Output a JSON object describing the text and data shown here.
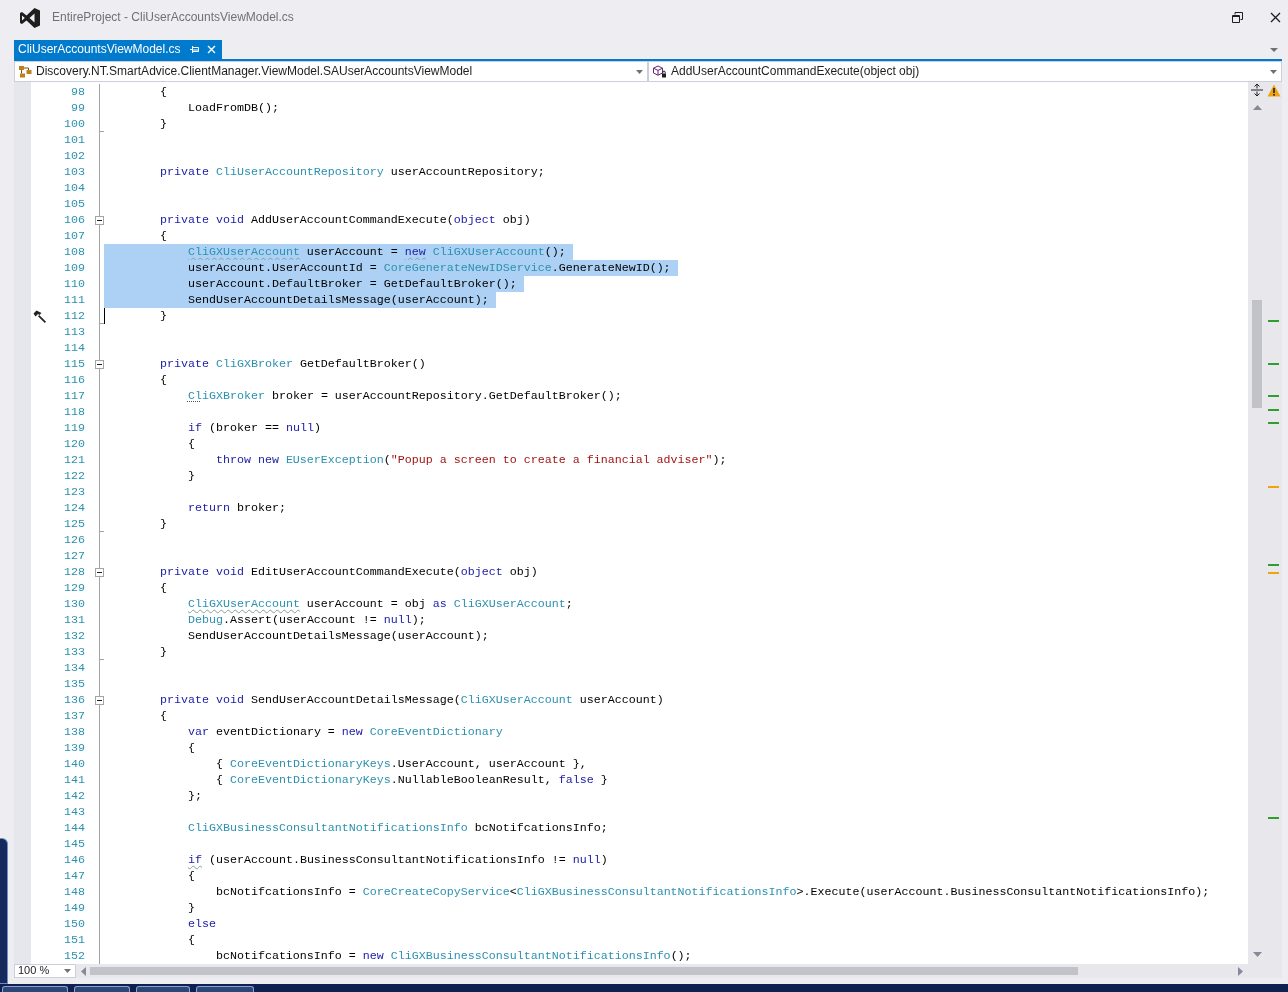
{
  "window": {
    "title": "EntireProject - CliUserAccountsViewModel.cs"
  },
  "tabs": [
    {
      "label": "CliUserAccountsViewModel.cs",
      "selected": true
    }
  ],
  "navigation_bar": {
    "type_scope": "Discovery.NT.SmartAdvice.ClientManager.ViewModel.SAUserAccountsViewModel",
    "member_scope": "AddUserAccountCommandExecute(object obj)"
  },
  "editor": {
    "lines": [
      {
        "number": "98",
        "selected": false,
        "tokens": [
          {
            "text": "        {",
            "kind": "plain"
          }
        ]
      },
      {
        "number": "99",
        "selected": false,
        "tokens": [
          {
            "text": "            LoadFromDB();",
            "kind": "plain"
          }
        ]
      },
      {
        "number": "100",
        "selected": false,
        "fold_end": true,
        "tokens": [
          {
            "text": "        }",
            "kind": "plain"
          }
        ]
      },
      {
        "number": "101",
        "selected": false
      },
      {
        "number": "102",
        "selected": false
      },
      {
        "number": "103",
        "selected": false,
        "tokens": [
          {
            "text": "        private ",
            "kind": "keyword"
          },
          {
            "text": "CliUserAccountRepository",
            "kind": "type"
          },
          {
            "text": " userAccountRepository;",
            "kind": "plain"
          }
        ]
      },
      {
        "number": "104",
        "selected": false
      },
      {
        "number": "105",
        "selected": false
      },
      {
        "number": "106",
        "selected": false,
        "expanded": true,
        "tokens": [
          {
            "text": "        private void ",
            "kind": "keyword"
          },
          {
            "text": "AddUserAccountCommandExecute(",
            "kind": "plain"
          },
          {
            "text": "object",
            "kind": "keyword"
          },
          {
            "text": " obj)",
            "kind": "plain"
          }
        ]
      },
      {
        "number": "107",
        "selected": false,
        "tokens": [
          {
            "text": "        {",
            "kind": "plain"
          }
        ]
      },
      {
        "number": "108",
        "selected": true,
        "tokens": [
          {
            "text": "            CliGXUserAccount",
            "kind": "type",
            "squiggle": true
          },
          {
            "text": " userAccount = ",
            "kind": "plain"
          },
          {
            "text": "new",
            "kind": "keyword",
            "squiggle": true
          },
          {
            "text": " CliGXUserAccount",
            "kind": "type"
          },
          {
            "text": "();",
            "kind": "plain"
          }
        ]
      },
      {
        "number": "109",
        "selected": true,
        "tokens": [
          {
            "text": "            userAccount.UserAccountId = ",
            "kind": "plain"
          },
          {
            "text": "CoreGenerateNewIDService",
            "kind": "type"
          },
          {
            "text": ".GenerateNewID();",
            "kind": "plain"
          }
        ]
      },
      {
        "number": "110",
        "selected": true,
        "tokens": [
          {
            "text": "            userAccount.DefaultBroker = GetDefaultBroker();",
            "kind": "plain"
          }
        ]
      },
      {
        "number": "111",
        "selected": true,
        "tokens": [
          {
            "text": "            SendUserAccountDetailsMessage(userAccount);",
            "kind": "plain"
          }
        ]
      },
      {
        "number": "112",
        "selected": false,
        "caret": true,
        "action_glyph": true,
        "fold_end": true,
        "tokens": [
          {
            "text": "        }",
            "kind": "plain"
          }
        ]
      },
      {
        "number": "113",
        "selected": false
      },
      {
        "number": "114",
        "selected": false
      },
      {
        "number": "115",
        "selected": false,
        "expanded": true,
        "tokens": [
          {
            "text": "        private ",
            "kind": "keyword"
          },
          {
            "text": "CliGXBroker",
            "kind": "type"
          },
          {
            "text": " GetDefaultBroker()",
            "kind": "plain"
          }
        ]
      },
      {
        "number": "116",
        "selected": false,
        "tokens": [
          {
            "text": "        {",
            "kind": "plain"
          }
        ]
      },
      {
        "number": "117",
        "selected": false,
        "tokens": [
          {
            "text": "            Cl",
            "kind": "type",
            "smart_tag": true
          },
          {
            "text": "iGXBroker",
            "kind": "type"
          },
          {
            "text": " broker = userAccountRepository.GetDefaultBroker();",
            "kind": "plain"
          }
        ]
      },
      {
        "number": "118",
        "selected": false
      },
      {
        "number": "119",
        "selected": false,
        "tokens": [
          {
            "text": "            if",
            "kind": "keyword"
          },
          {
            "text": " (broker == ",
            "kind": "plain"
          },
          {
            "text": "null",
            "kind": "keyword"
          },
          {
            "text": ")",
            "kind": "plain"
          }
        ]
      },
      {
        "number": "120",
        "selected": false,
        "tokens": [
          {
            "text": "            {",
            "kind": "plain"
          }
        ]
      },
      {
        "number": "121",
        "selected": false,
        "tokens": [
          {
            "text": "                throw new ",
            "kind": "keyword"
          },
          {
            "text": "EUserException",
            "kind": "type"
          },
          {
            "text": "(",
            "kind": "plain"
          },
          {
            "text": "\"Popup a screen to create a financial adviser\"",
            "kind": "string"
          },
          {
            "text": ");",
            "kind": "plain"
          }
        ]
      },
      {
        "number": "122",
        "selected": false,
        "tokens": [
          {
            "text": "            }",
            "kind": "plain"
          }
        ]
      },
      {
        "number": "123",
        "selected": false
      },
      {
        "number": "124",
        "selected": false,
        "tokens": [
          {
            "text": "            return",
            "kind": "keyword"
          },
          {
            "text": " broker;",
            "kind": "plain"
          }
        ]
      },
      {
        "number": "125",
        "selected": false,
        "fold_end": true,
        "tokens": [
          {
            "text": "        }",
            "kind": "plain"
          }
        ]
      },
      {
        "number": "126",
        "selected": false
      },
      {
        "number": "127",
        "selected": false
      },
      {
        "number": "128",
        "selected": false,
        "expanded": true,
        "tokens": [
          {
            "text": "        private void ",
            "kind": "keyword"
          },
          {
            "text": "EditUserAccountCommandExecute(",
            "kind": "plain"
          },
          {
            "text": "object",
            "kind": "keyword"
          },
          {
            "text": " obj)",
            "kind": "plain"
          }
        ]
      },
      {
        "number": "129",
        "selected": false,
        "tokens": [
          {
            "text": "        {",
            "kind": "plain"
          }
        ]
      },
      {
        "number": "130",
        "selected": false,
        "tokens": [
          {
            "text": "            CliGXUserAccount",
            "kind": "type",
            "squiggle": true
          },
          {
            "text": " userAccount = obj ",
            "kind": "plain"
          },
          {
            "text": "as",
            "kind": "keyword"
          },
          {
            "text": " CliGXUserAccount",
            "kind": "type"
          },
          {
            "text": ";",
            "kind": "plain"
          }
        ]
      },
      {
        "number": "131",
        "selected": false,
        "tokens": [
          {
            "text": "            Debug",
            "kind": "type"
          },
          {
            "text": ".Assert(userAccount != ",
            "kind": "plain"
          },
          {
            "text": "null",
            "kind": "keyword"
          },
          {
            "text": ");",
            "kind": "plain"
          }
        ]
      },
      {
        "number": "132",
        "selected": false,
        "tokens": [
          {
            "text": "            SendUserAccountDetailsMessage(userAccount);",
            "kind": "plain"
          }
        ]
      },
      {
        "number": "133",
        "selected": false,
        "fold_end": true,
        "tokens": [
          {
            "text": "        }",
            "kind": "plain"
          }
        ]
      },
      {
        "number": "134",
        "selected": false
      },
      {
        "number": "135",
        "selected": false
      },
      {
        "number": "136",
        "selected": false,
        "expanded": true,
        "tokens": [
          {
            "text": "        private void ",
            "kind": "keyword"
          },
          {
            "text": "SendUserAccountDetailsMessage(",
            "kind": "plain"
          },
          {
            "text": "CliGXUserAccount",
            "kind": "type"
          },
          {
            "text": " userAccount)",
            "kind": "plain"
          }
        ]
      },
      {
        "number": "137",
        "selected": false,
        "tokens": [
          {
            "text": "        {",
            "kind": "plain"
          }
        ]
      },
      {
        "number": "138",
        "selected": false,
        "tokens": [
          {
            "text": "            var",
            "kind": "keyword"
          },
          {
            "text": " eventDictionary = ",
            "kind": "plain"
          },
          {
            "text": "new",
            "kind": "keyword"
          },
          {
            "text": " CoreEventDictionary",
            "kind": "type"
          }
        ]
      },
      {
        "number": "139",
        "selected": false,
        "tokens": [
          {
            "text": "            {",
            "kind": "plain"
          }
        ]
      },
      {
        "number": "140",
        "selected": false,
        "tokens": [
          {
            "text": "                { ",
            "kind": "plain"
          },
          {
            "text": "CoreEventDictionaryKeys",
            "kind": "type"
          },
          {
            "text": ".UserAccount, userAccount },",
            "kind": "plain"
          }
        ]
      },
      {
        "number": "141",
        "selected": false,
        "tokens": [
          {
            "text": "                { ",
            "kind": "plain"
          },
          {
            "text": "CoreEventDictionaryKeys",
            "kind": "type"
          },
          {
            "text": ".NullableBooleanResult, ",
            "kind": "plain"
          },
          {
            "text": "false",
            "kind": "keyword"
          },
          {
            "text": " }",
            "kind": "plain"
          }
        ]
      },
      {
        "number": "142",
        "selected": false,
        "tokens": [
          {
            "text": "            };",
            "kind": "plain"
          }
        ]
      },
      {
        "number": "143",
        "selected": false
      },
      {
        "number": "144",
        "selected": false,
        "tokens": [
          {
            "text": "            CliGXBusinessConsultantNotificationsInfo",
            "kind": "type"
          },
          {
            "text": " bcNotifcationsInfo;",
            "kind": "plain"
          }
        ]
      },
      {
        "number": "145",
        "selected": false
      },
      {
        "number": "146",
        "selected": false,
        "tokens": [
          {
            "text": "            if",
            "kind": "keyword",
            "squiggle": true
          },
          {
            "text": " (userAccount.BusinessConsultantNotificationsInfo != ",
            "kind": "plain"
          },
          {
            "text": "null",
            "kind": "keyword"
          },
          {
            "text": ")",
            "kind": "plain"
          }
        ]
      },
      {
        "number": "147",
        "selected": false,
        "tokens": [
          {
            "text": "            {",
            "kind": "plain"
          }
        ]
      },
      {
        "number": "148",
        "selected": false,
        "tokens": [
          {
            "text": "                bcNotifcationsInfo = ",
            "kind": "plain"
          },
          {
            "text": "CoreCreateCopyService",
            "kind": "type"
          },
          {
            "text": "<",
            "kind": "plain"
          },
          {
            "text": "CliGXBusinessConsultantNotificationsInfo",
            "kind": "type"
          },
          {
            "text": ">.Execute(userAccount.BusinessConsultantNotificationsInfo);",
            "kind": "plain"
          }
        ]
      },
      {
        "number": "149",
        "selected": false,
        "tokens": [
          {
            "text": "            }",
            "kind": "plain"
          }
        ]
      },
      {
        "number": "150",
        "selected": false,
        "tokens": [
          {
            "text": "            else",
            "kind": "keyword"
          }
        ]
      },
      {
        "number": "151",
        "selected": false,
        "tokens": [
          {
            "text": "            {",
            "kind": "plain"
          }
        ]
      },
      {
        "number": "152",
        "selected": false,
        "tokens": [
          {
            "text": "                bcNotifcationsInfo = ",
            "kind": "plain"
          },
          {
            "text": "new",
            "kind": "keyword"
          },
          {
            "text": " CliGXBusinessConsultantNotificationsInfo",
            "kind": "type"
          },
          {
            "text": "();",
            "kind": "plain"
          }
        ]
      }
    ],
    "overview_marks": [
      {
        "color": "#2e9e2e"
      },
      {
        "color": "#2e9e2e"
      },
      {
        "color": "#2e9e2e"
      },
      {
        "color": "#2e9e2e"
      },
      {
        "color": "#2e9e2e"
      },
      {
        "color": "#f0a30a"
      },
      {
        "color": "#2e9e2e"
      },
      {
        "color": "#f0a30a"
      },
      {
        "color": "#2e9e2e"
      }
    ],
    "zoom": "100 %"
  }
}
